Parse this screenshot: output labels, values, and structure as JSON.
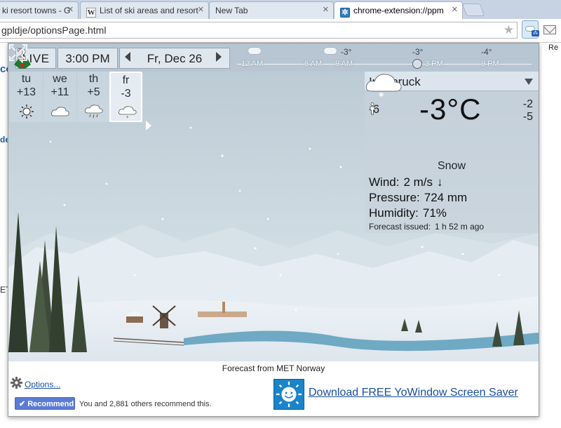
{
  "tabs": [
    {
      "label": "ki resort towns - G"
    },
    {
      "label": "List of ski areas and resort"
    },
    {
      "label": "New Tab"
    },
    {
      "label": "chrome-extension://ppm"
    }
  ],
  "address": {
    "value": "gpldje/optionsPage.html"
  },
  "background_page": {
    "edge_text_1": "co",
    "edge_text_2": "de",
    "edge_text_3": "ET",
    "right_edge": "Re"
  },
  "topbar": {
    "live": "LIVE",
    "time": "3:00 PM",
    "date": "Fr, Dec 26",
    "timeline_times": [
      "12 AM",
      "6 AM",
      "9 AM",
      "3 PM",
      "9 PM"
    ],
    "timeline_temps": [
      "-3°",
      "-3°",
      "-4°"
    ]
  },
  "days": [
    {
      "name": "tu",
      "temp": "+13",
      "icon": "sun-icon"
    },
    {
      "name": "we",
      "temp": "+11",
      "icon": "cloud-icon"
    },
    {
      "name": "th",
      "temp": "+5",
      "icon": "rain-cloud-icon"
    },
    {
      "name": "fr",
      "temp": "-3",
      "icon": "snow-cloud-icon"
    }
  ],
  "current": {
    "city": "Innsbruck",
    "feels_like": "-6",
    "temperature": "-3°C",
    "high": "-2",
    "low": "-5",
    "condition": "Snow",
    "wind_label": "Wind:",
    "wind_value": "2 m/s",
    "wind_arrow": "↓",
    "pressure_label": "Pressure:",
    "pressure_value": "724 mm",
    "humidity_label": "Humidity:",
    "humidity_value": "71%",
    "issued_label": "Forecast issued:",
    "issued_value": "1 h 52 m ago"
  },
  "scene_badge": "2",
  "footer": {
    "source": "Forecast from MET Norway",
    "options": "Options...",
    "recommend": "Recommend",
    "recommend_text": "You and 2,881 others recommend this.",
    "saver": "Download FREE YoWindow Screen Saver"
  },
  "colors": {
    "accent_link": "#1a4fa0",
    "recommend": "#5b7bd5",
    "sky": "#c9d6de",
    "snow": "#f2f5f8"
  }
}
